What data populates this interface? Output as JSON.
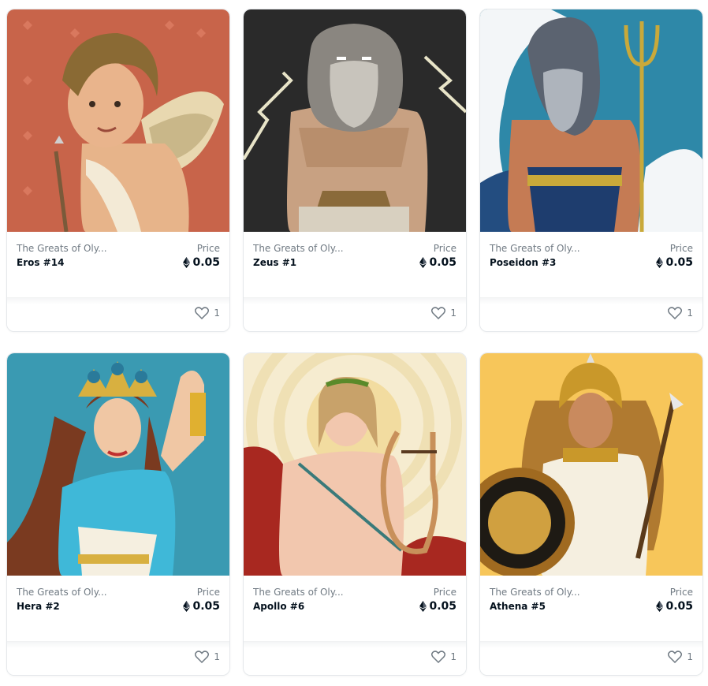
{
  "cards": [
    {
      "collection": "The Greats of Oly...",
      "name": "Eros #14",
      "price_label": "Price",
      "price": "0.05",
      "likes": "1",
      "bg": "#c8644a"
    },
    {
      "collection": "The Greats of Oly...",
      "name": "Zeus #1",
      "price_label": "Price",
      "price": "0.05",
      "likes": "1",
      "bg": "#2a2a2a"
    },
    {
      "collection": "The Greats of Oly...",
      "name": "Poseidon #3",
      "price_label": "Price",
      "price": "0.05",
      "likes": "1",
      "bg": "#2e88a8"
    },
    {
      "collection": "The Greats of Oly...",
      "name": "Hera #2",
      "price_label": "Price",
      "price": "0.05",
      "likes": "1",
      "bg": "#3a9ab2"
    },
    {
      "collection": "The Greats of Oly...",
      "name": "Apollo #6",
      "price_label": "Price",
      "price": "0.05",
      "likes": "1",
      "bg": "#f6ecd0"
    },
    {
      "collection": "The Greats of Oly...",
      "name": "Athena #5",
      "price_label": "Price",
      "price": "0.05",
      "likes": "1",
      "bg": "#f7c65a"
    }
  ],
  "icons": {
    "currency": "ethereum-icon",
    "like": "heart-icon"
  }
}
